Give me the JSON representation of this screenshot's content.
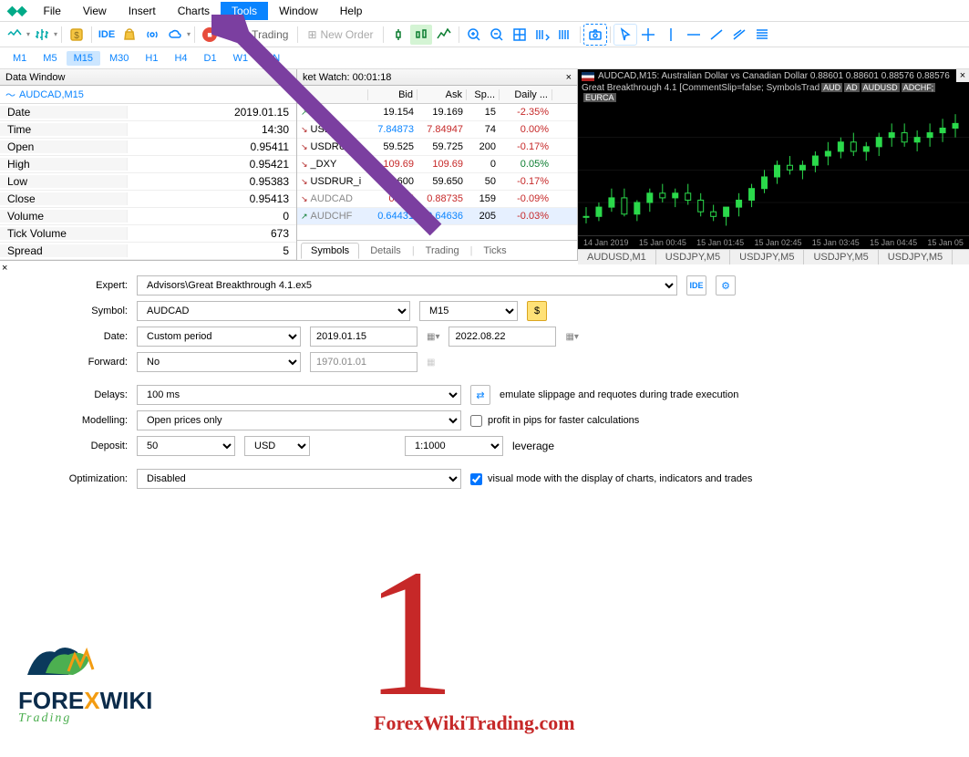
{
  "menubar": {
    "items": [
      "File",
      "View",
      "Insert",
      "Charts",
      "Tools",
      "Window",
      "Help"
    ],
    "highlight_index": 4
  },
  "toolbar": {
    "ide": "IDE",
    "algo": "Algo Trading",
    "neworder": "New Order"
  },
  "timeframes": {
    "items": [
      "M1",
      "M5",
      "M15",
      "M30",
      "H1",
      "H4",
      "D1",
      "W1",
      "MN"
    ],
    "active_index": 2
  },
  "data_window": {
    "title": "Data Window",
    "symbol": "AUDCAD,M15",
    "rows": [
      {
        "k": "Date",
        "v": "2019.01.15"
      },
      {
        "k": "Time",
        "v": "14:30"
      },
      {
        "k": "Open",
        "v": "0.95411"
      },
      {
        "k": "High",
        "v": "0.95421"
      },
      {
        "k": "Low",
        "v": "0.95383"
      },
      {
        "k": "Close",
        "v": "0.95413"
      },
      {
        "k": "Volume",
        "v": "0"
      },
      {
        "k": "Tick Volume",
        "v": "673"
      },
      {
        "k": "Spread",
        "v": "5"
      }
    ]
  },
  "market_watch": {
    "title": "ket Watch: 00:01:18",
    "headers": {
      "sym": "S",
      "bid": "Bid",
      "ask": "Ask",
      "sp": "Sp...",
      "daily": "Daily ..."
    },
    "rows": [
      {
        "dir": "up",
        "sym": "XA",
        "bid": "19.154",
        "ask": "19.169",
        "sp": "15",
        "daily": "-2.35%",
        "bid_cls": "",
        "ask_cls": "",
        "daily_cls": "red"
      },
      {
        "dir": "dn",
        "sym": "USDH",
        "bid": "7.84873",
        "ask": "7.84947",
        "sp": "74",
        "daily": "0.00%",
        "bid_cls": "blue",
        "ask_cls": "red",
        "daily_cls": "red"
      },
      {
        "dir": "dn",
        "sym": "USDRUR",
        "bid": "59.525",
        "ask": "59.725",
        "sp": "200",
        "daily": "-0.17%",
        "bid_cls": "",
        "ask_cls": "",
        "daily_cls": "red"
      },
      {
        "dir": "dn",
        "sym": "_DXY",
        "bid": "109.69",
        "ask": "109.69",
        "sp": "0",
        "daily": "0.05%",
        "bid_cls": "red",
        "ask_cls": "red",
        "daily_cls": "green"
      },
      {
        "dir": "dn",
        "sym": "USDRUR_i",
        "bid": "600",
        "ask": "59.650",
        "sp": "50",
        "daily": "-0.17%",
        "bid_cls": "",
        "ask_cls": "",
        "daily_cls": "red"
      },
      {
        "dir": "dn",
        "sym": "AUDCAD",
        "bid": "0.885",
        "ask": "0.88735",
        "sp": "159",
        "daily": "-0.09%",
        "bid_cls": "red",
        "ask_cls": "red",
        "daily_cls": "red",
        "gray_sym": true
      },
      {
        "dir": "up",
        "sym": "AUDCHF",
        "bid": "0.64431",
        "ask": "0.64636",
        "sp": "205",
        "daily": "-0.03%",
        "bid_cls": "blue",
        "ask_cls": "blue",
        "daily_cls": "red",
        "gray_sym": true,
        "sel": true
      }
    ],
    "tabs": [
      "Symbols",
      "Details",
      "Trading",
      "Ticks"
    ],
    "active_tab": 0
  },
  "chart": {
    "title": "AUDCAD,M15: Australian Dollar vs Canadian Dollar 0.88601 0.88601 0.88576 0.88576",
    "subtitle_prefix": "Great Breakthrough 4.1 [CommentSlip=false; SymbolsTrad",
    "subtitle_boxes": [
      "AUD",
      "AD",
      "AUDUSD",
      "ADCHF;",
      "EURCA"
    ],
    "xaxis": [
      "14 Jan 2019",
      "15 Jan 00:45",
      "15 Jan 01:45",
      "15 Jan 02:45",
      "15 Jan 03:45",
      "15 Jan 04:45",
      "15 Jan 05"
    ],
    "tabs": [
      "AUDUSD,M1",
      "USDJPY,M5",
      "USDJPY,M5",
      "USDJPY,M5",
      "USDJPY,M5"
    ]
  },
  "tester": {
    "labels": {
      "expert": "Expert:",
      "symbol": "Symbol:",
      "date": "Date:",
      "forward": "Forward:",
      "delays": "Delays:",
      "modelling": "Modelling:",
      "deposit": "Deposit:",
      "optimization": "Optimization:",
      "leverage": "leverage"
    },
    "expert": "Advisors\\Great Breakthrough 4.1.ex5",
    "symbol": "AUDCAD",
    "timeframe": "M15",
    "date_mode": "Custom period",
    "date_from": "2019.01.15",
    "date_to": "2022.08.22",
    "forward": "No",
    "forward_date": "1970.01.01",
    "delays": "100 ms",
    "modelling": "Open prices only",
    "deposit": "50",
    "currency": "USD",
    "leverage": "1:1000",
    "optimization": "Disabled",
    "chk_slippage": "emulate slippage and requotes during trade execution",
    "chk_pips": "profit in pips for faster calculations",
    "chk_visual": "visual mode with the display of charts, indicators and trades",
    "ide_btn": "IDE"
  },
  "annotations": {
    "step": "1",
    "watermark": "ForexWikiTrading.com",
    "logo_main1": "FORE",
    "logo_x": "X",
    "logo_main2": "WIKI",
    "logo_sub": "Trading"
  },
  "chart_data": {
    "type": "candlestick",
    "title": "AUDCAD,M15",
    "note": "values estimated from pixels",
    "x": [
      0,
      1,
      2,
      3,
      4,
      5,
      6,
      7,
      8,
      9,
      10,
      11,
      12,
      13,
      14,
      15,
      16,
      17,
      18,
      19,
      20,
      21,
      22,
      23,
      24,
      25,
      26,
      27,
      28,
      29
    ],
    "open": [
      0.9458,
      0.9458,
      0.9462,
      0.9466,
      0.9459,
      0.9464,
      0.9468,
      0.9466,
      0.9468,
      0.9465,
      0.946,
      0.9458,
      0.9462,
      0.9465,
      0.947,
      0.9475,
      0.948,
      0.9478,
      0.948,
      0.9484,
      0.9486,
      0.949,
      0.9486,
      0.9488,
      0.9492,
      0.9494,
      0.949,
      0.9492,
      0.9494,
      0.9496
    ],
    "high": [
      0.9462,
      0.9464,
      0.947,
      0.947,
      0.9465,
      0.947,
      0.9472,
      0.947,
      0.9472,
      0.9468,
      0.9463,
      0.9462,
      0.9468,
      0.9472,
      0.9478,
      0.9482,
      0.9484,
      0.9482,
      0.9486,
      0.949,
      0.9492,
      0.9494,
      0.949,
      0.9494,
      0.9498,
      0.9498,
      0.9495,
      0.9498,
      0.95,
      0.9502
    ],
    "low": [
      0.9455,
      0.9456,
      0.946,
      0.9458,
      0.9456,
      0.946,
      0.9464,
      0.9462,
      0.9463,
      0.9458,
      0.9456,
      0.9454,
      0.9458,
      0.9462,
      0.9468,
      0.9472,
      0.9476,
      0.9474,
      0.9477,
      0.948,
      0.9483,
      0.9484,
      0.9482,
      0.9484,
      0.9488,
      0.9488,
      0.9486,
      0.9488,
      0.949,
      0.9492
    ],
    "close": [
      0.9458,
      0.9462,
      0.9466,
      0.9459,
      0.9464,
      0.9468,
      0.9466,
      0.9468,
      0.9465,
      0.946,
      0.9458,
      0.9462,
      0.9465,
      0.947,
      0.9475,
      0.948,
      0.9478,
      0.948,
      0.9484,
      0.9486,
      0.949,
      0.9486,
      0.9488,
      0.9492,
      0.9494,
      0.949,
      0.9492,
      0.9494,
      0.9496,
      0.9498
    ]
  }
}
